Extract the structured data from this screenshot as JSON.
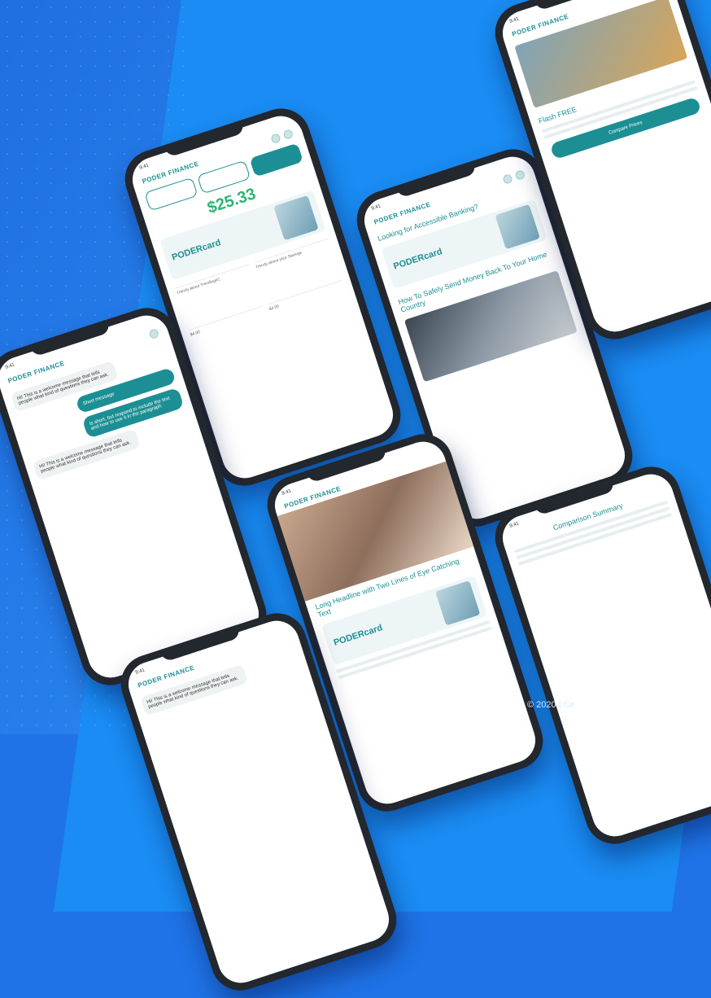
{
  "brand": {
    "logo": "PODER FINANCE"
  },
  "phone1": {
    "time": "9:41",
    "tabs": [
      "",
      "",
      ""
    ],
    "balance_label": "",
    "balance": "$25.33",
    "card_brand": "PODERcard",
    "grid": [
      "Trendy about Trending#1",
      "Trendy about your Savings",
      "$4.00",
      "$4.00"
    ]
  },
  "phone2": {
    "time": "9:41",
    "messages": [
      {
        "side": "left",
        "text": "Hi! This is a welcome message that tells people what kind of questions they can ask."
      },
      {
        "side": "right",
        "text": "Short message"
      },
      {
        "side": "right",
        "text": "Is short, but respond to include the text and how to use it in the paragraph"
      },
      {
        "side": "left",
        "text": "Hi! This is a welcome message that tells people what kind of questions they can ask."
      }
    ]
  },
  "phone3": {
    "time": "9:41",
    "section": "Looking for Accessible Banking?",
    "card_brand": "PODERcard",
    "article": "How To Safely Send Money Back To Your Home Country"
  },
  "phone4": {
    "time": "9:41",
    "banner": "Flash FREE",
    "button": "Compare Prices"
  },
  "phone5": {
    "time": "9:41",
    "headline": "Long Headline with Two Lines of Eye Catching Text",
    "card_brand": "PODERcard"
  },
  "phone6": {
    "time": "9:41",
    "title": "Comparison Summary"
  },
  "phone7": {
    "time": "9:41",
    "message": "Hi! This is a welcome message that tells people what kind of questions they can ask."
  },
  "copyright": "© 2020 | Ce",
  "colors": {
    "accent": "#1c8f94",
    "money": "#2bb673",
    "bg": "#1f73e6"
  }
}
